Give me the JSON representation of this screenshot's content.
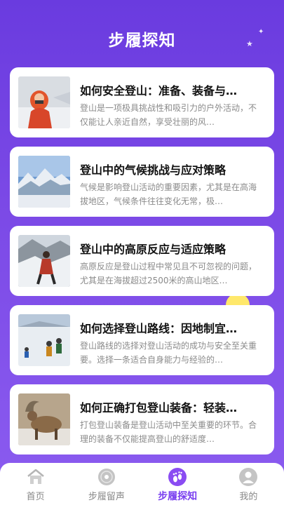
{
  "header": {
    "title": "步履探知"
  },
  "articles": [
    {
      "title": "如何安全登山：准备、装备与…",
      "desc": "登山是一项极具挑战性和吸引力的户外活动，不仅能让人亲近自然，享受壮丽的风…"
    },
    {
      "title": "登山中的气候挑战与应对策略",
      "desc": "气候是影响登山活动的重要因素，尤其是在高海拔地区，气候条件往往变化无常，极…"
    },
    {
      "title": "登山中的高原反应与适应策略",
      "desc": "高原反应是登山过程中常见且不可忽视的问题，尤其是在海拔超过2500米的高山地区…"
    },
    {
      "title": "如何选择登山路线：因地制宜…",
      "desc": "登山路线的选择对登山活动的成功与安全至关重要。选择一条适合自身能力与经验的…"
    },
    {
      "title": "如何正确打包登山装备：轻装…",
      "desc": "打包登山装备是登山活动中至关重要的环节。合理的装备不仅能提高登山的舒适度…"
    }
  ],
  "tabs": [
    {
      "label": "首页",
      "icon": "home-icon"
    },
    {
      "label": "步履留声",
      "icon": "vinyl-record-icon"
    },
    {
      "label": "步履探知",
      "icon": "footprints-icon",
      "active": true
    },
    {
      "label": "我的",
      "icon": "user-icon"
    }
  ],
  "colors": {
    "accent": "#7a3ff0",
    "background": "#7044e2",
    "moon": "#ffe86b"
  }
}
